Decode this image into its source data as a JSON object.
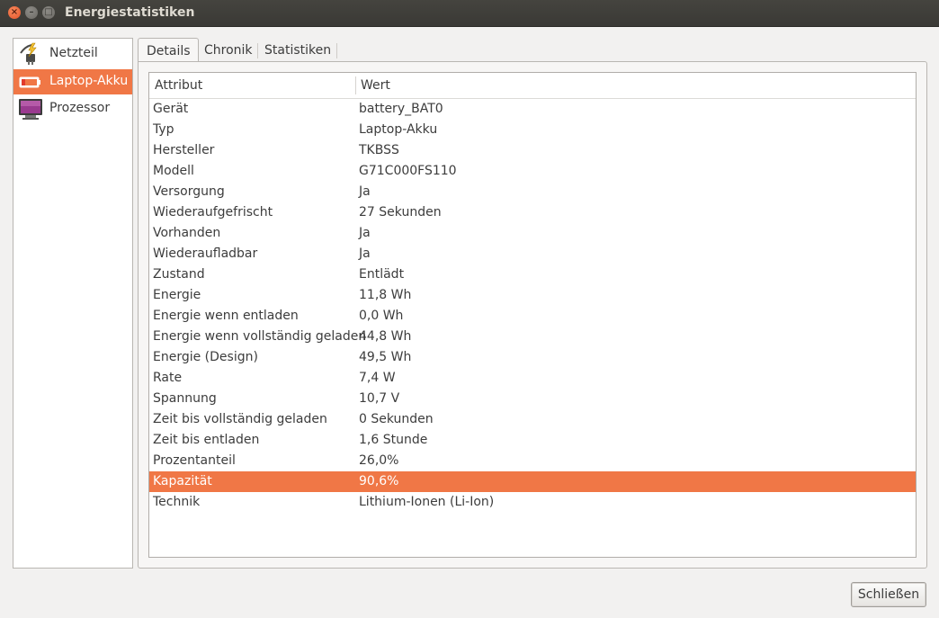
{
  "window": {
    "title": "Energiestatistiken"
  },
  "devices": [
    {
      "label": "Netzteil",
      "icon": "power-supply-icon",
      "selected": false
    },
    {
      "label": "Laptop-Akku",
      "icon": "battery-icon",
      "selected": true
    },
    {
      "label": "Prozessor",
      "icon": "monitor-icon",
      "selected": false
    }
  ],
  "tabs": [
    {
      "label": "Details",
      "active": true
    },
    {
      "label": "Chronik",
      "active": false
    },
    {
      "label": "Statistiken",
      "active": false
    }
  ],
  "table": {
    "headers": [
      "Attribut",
      "Wert"
    ],
    "rows": [
      [
        "Gerät",
        "battery_BAT0"
      ],
      [
        "Typ",
        "Laptop-Akku"
      ],
      [
        "Hersteller",
        "TKBSS"
      ],
      [
        "Modell",
        "G71C000FS110"
      ],
      [
        "Versorgung",
        "Ja"
      ],
      [
        "Wiederaufgefrischt",
        "27 Sekunden"
      ],
      [
        "Vorhanden",
        "Ja"
      ],
      [
        "Wiederaufladbar",
        "Ja"
      ],
      [
        "Zustand",
        "Entlädt"
      ],
      [
        "Energie",
        "11,8 Wh"
      ],
      [
        "Energie wenn entladen",
        "0,0 Wh"
      ],
      [
        "Energie wenn vollständig geladen",
        "44,8 Wh"
      ],
      [
        "Energie (Design)",
        "49,5 Wh"
      ],
      [
        "Rate",
        "7,4 W"
      ],
      [
        "Spannung",
        "10,7 V"
      ],
      [
        "Zeit bis vollständig geladen",
        "0 Sekunden"
      ],
      [
        "Zeit bis entladen",
        "1,6 Stunde"
      ],
      [
        "Prozentanteil",
        "26,0%"
      ],
      [
        "Kapazität",
        "90,6%"
      ],
      [
        "Technik",
        "Lithium-Ionen (Li-Ion)"
      ]
    ],
    "selected_row": 18
  },
  "buttons": {
    "close": "Schließen"
  },
  "colors": {
    "accent": "#f07746",
    "titlebar": "#3c3b37"
  }
}
